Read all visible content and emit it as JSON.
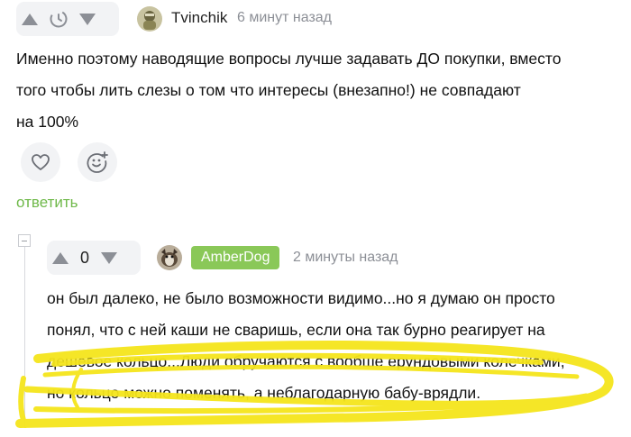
{
  "comment1": {
    "vote_count": "",
    "username": "Tvinchik",
    "time": "6 минут назад",
    "text_lines": [
      "Именно поэтому наводящие вопросы лучше задавать ДО покупки, вместо",
      "того чтобы лить слезы о том что интересы (внезапно!) не совпадают",
      "на 100%"
    ],
    "reply_label": "ответить",
    "icons": {
      "upvote": "arrow-up-icon",
      "timer": "timer-icon",
      "downvote": "arrow-down-icon",
      "like": "heart-icon",
      "react": "add-emoji-icon"
    }
  },
  "comment2": {
    "vote_count": "0",
    "username": "AmberDog",
    "time": "2 минуты назад",
    "text_lines": [
      "он был далеко, не было возможности видимо...но я думаю он просто",
      "понял, что с ней каши не сваришь, если она так бурно реагирует на",
      "дешевое кольцо...Люди обручаются с вообше ерундовыми колечками,",
      "но кольцо можно поменять, а неблагодарную бабу-врядли."
    ]
  },
  "colors": {
    "accent_green": "#6fb94a",
    "badge_green": "#8ac858",
    "highlight_yellow": "#f5e51c",
    "pill_bg": "#f2f3f5",
    "muted": "#8c8f96"
  }
}
